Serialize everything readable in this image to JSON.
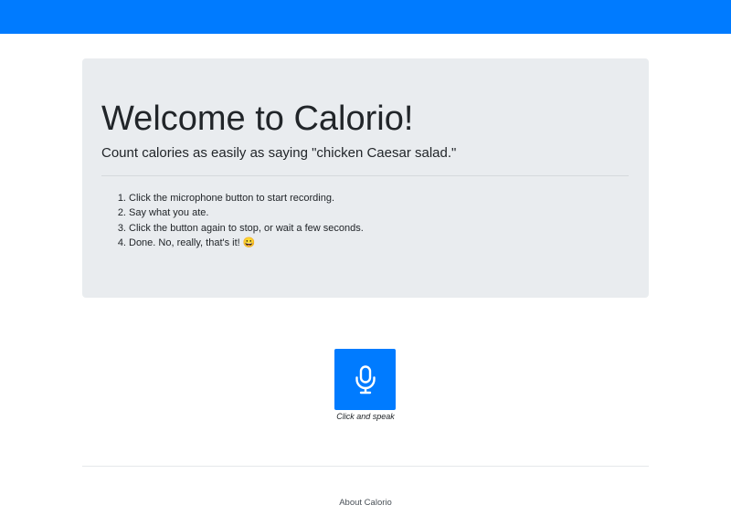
{
  "jumbotron": {
    "title": "Welcome to Calorio!",
    "lead": "Count calories as easily as saying \"chicken Caesar salad.\"",
    "steps": [
      {
        "num": "1.",
        "text": "Click the microphone button to start recording."
      },
      {
        "num": "2.",
        "text": "Say what you ate."
      },
      {
        "num": "3.",
        "text": "Click the button again to stop, or wait a few seconds."
      },
      {
        "num": "4.",
        "text": "Done. No, really, that's it!",
        "emoji": "😀"
      }
    ]
  },
  "mic": {
    "icon": "microphone-icon",
    "caption": "Click and speak"
  },
  "footer": {
    "about_label": "About Calorio"
  },
  "colors": {
    "brand": "#007bff",
    "jumbotron_bg": "#e9ecef",
    "text": "#212529"
  }
}
